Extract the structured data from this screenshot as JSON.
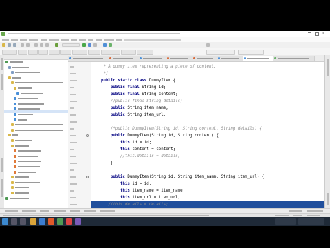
{
  "code_lines": [
    [
      {
        "t": "     * A dummy item representing a piece of content.",
        "c": "cm"
      }
    ],
    [
      {
        "t": "     */",
        "c": "cm"
      }
    ],
    [
      {
        "t": "    public static class ",
        "c": "kw"
      },
      {
        "t": "DummyItem {",
        "c": ""
      }
    ],
    [
      {
        "t": "        public final ",
        "c": "kw"
      },
      {
        "t": "String id;",
        "c": ""
      }
    ],
    [
      {
        "t": "        public final ",
        "c": "kw"
      },
      {
        "t": "String content;",
        "c": ""
      }
    ],
    [
      {
        "t": "        //public final String details;",
        "c": "cm"
      }
    ],
    [
      {
        "t": "        public ",
        "c": "kw"
      },
      {
        "t": "String item_name;",
        "c": ""
      }
    ],
    [
      {
        "t": "        public ",
        "c": "kw"
      },
      {
        "t": "String item_url;",
        "c": ""
      }
    ],
    [
      {
        "t": "",
        "c": ""
      }
    ],
    [
      {
        "t": "        /*public DummyItem(String id, String content, String details) {",
        "c": "cm"
      }
    ],
    [
      {
        "t": "        public ",
        "c": "kw"
      },
      {
        "t": "DummyItem(String id, String content) {",
        "c": ""
      }
    ],
    [
      {
        "t": "            this",
        "c": "kw"
      },
      {
        "t": ".id = id;",
        "c": ""
      }
    ],
    [
      {
        "t": "            this",
        "c": "kw"
      },
      {
        "t": ".content = content;",
        "c": ""
      }
    ],
    [
      {
        "t": "            //this.details = details;",
        "c": "cm"
      }
    ],
    [
      {
        "t": "        }",
        "c": ""
      }
    ],
    [
      {
        "t": "",
        "c": ""
      }
    ],
    [
      {
        "t": "        public ",
        "c": "kw"
      },
      {
        "t": "DummyItem(String id, String item_name, String item_url) {",
        "c": ""
      }
    ],
    [
      {
        "t": "            this",
        "c": "kw"
      },
      {
        "t": ".id = id;",
        "c": ""
      }
    ],
    [
      {
        "t": "            this",
        "c": "kw"
      },
      {
        "t": ".item_name = item_name;",
        "c": ""
      }
    ],
    [
      {
        "t": "            this",
        "c": "kw"
      },
      {
        "t": ".item_url = item_url;",
        "c": ""
      }
    ],
    [
      {
        "t": "       ",
        "c": ""
      },
      {
        "t": "//this.details = details;",
        "c": "cm"
      }
    ],
    [
      {
        "t": "",
        "c": ""
      }
    ]
  ],
  "highlighted_line": 20,
  "colors": {
    "keyword": "#000080",
    "comment": "#8c8c8c",
    "selection": "#1f4e9c",
    "gutter": "#f5f5f5",
    "tree_selection": "#d5e4f7"
  },
  "icons": {
    "app": "android-studio-icon",
    "folder": "folder-icon",
    "class": "java-class-icon",
    "gutter_breakpoint": "override-method-icon"
  }
}
